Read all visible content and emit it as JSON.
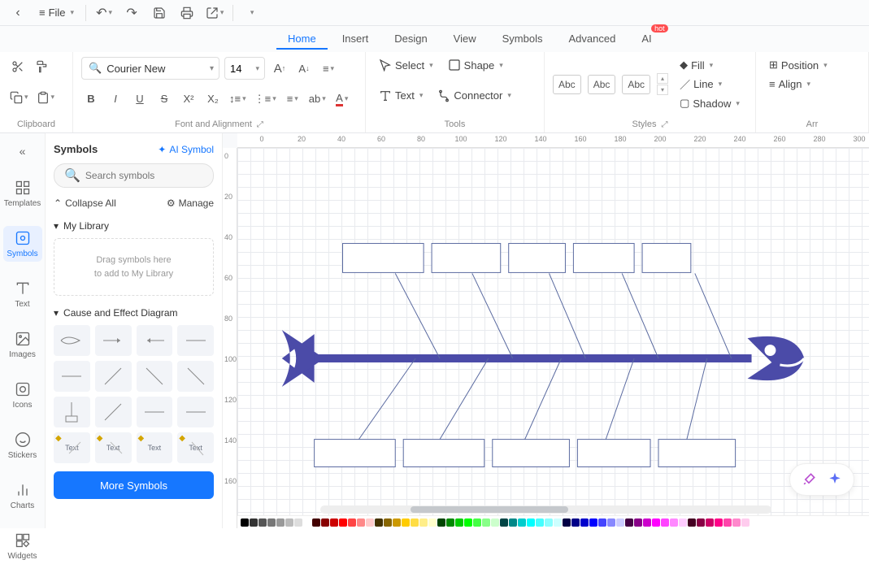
{
  "titlebar": {
    "file_label": "File"
  },
  "menu": {
    "items": [
      "Home",
      "Insert",
      "Design",
      "View",
      "Symbols",
      "Advanced",
      "AI"
    ],
    "active": 0,
    "hot_label": "hot"
  },
  "ribbon": {
    "clipboard_label": "Clipboard",
    "font": {
      "name": "Courier New",
      "size": "14"
    },
    "font_align_label": "Font and Alignment",
    "tools": {
      "select": "Select",
      "shape": "Shape",
      "text": "Text",
      "connector": "Connector",
      "label": "Tools"
    },
    "styles": {
      "abc": "Abc",
      "label": "Styles",
      "fill": "Fill",
      "line": "Line",
      "shadow": "Shadow"
    },
    "arrange": {
      "position": "Position",
      "align": "Align",
      "label": "Arr"
    }
  },
  "leftbar": {
    "items": [
      {
        "label": "Templates"
      },
      {
        "label": "Symbols"
      },
      {
        "label": "Text"
      },
      {
        "label": "Images"
      },
      {
        "label": "Icons"
      },
      {
        "label": "Stickers"
      },
      {
        "label": "Charts"
      },
      {
        "label": "Widgets"
      }
    ],
    "active": 1
  },
  "symbols_panel": {
    "title": "Symbols",
    "ai_symbol": "AI Symbol",
    "search_placeholder": "Search symbols",
    "collapse_all": "Collapse All",
    "manage": "Manage",
    "my_library": "My Library",
    "drop_hint_line1": "Drag symbols here",
    "drop_hint_line2": "to add to My Library",
    "cause_effect": "Cause and Effect Diagram",
    "text_label": "Text",
    "more_symbols": "More Symbols"
  },
  "ruler_h": [
    0,
    20,
    40,
    60,
    80,
    100,
    120,
    140,
    160,
    180,
    200,
    220,
    240,
    260,
    280,
    300
  ],
  "ruler_v": [
    0,
    20,
    40,
    60,
    80,
    100,
    120,
    140,
    160
  ],
  "colors": [
    "#000",
    "#333",
    "#555",
    "#777",
    "#999",
    "#bbb",
    "#ddd",
    "#fff",
    "#400",
    "#800",
    "#c00",
    "#f00",
    "#f44",
    "#f88",
    "#fcc",
    "#430",
    "#860",
    "#c90",
    "#fc0",
    "#fd4",
    "#fe8",
    "#ffc",
    "#040",
    "#080",
    "#0c0",
    "#0f0",
    "#4f4",
    "#8f8",
    "#cfc",
    "#044",
    "#088",
    "#0cc",
    "#0ff",
    "#4ff",
    "#8ff",
    "#cff",
    "#004",
    "#008",
    "#00c",
    "#00f",
    "#44f",
    "#88f",
    "#ccf",
    "#404",
    "#808",
    "#c0c",
    "#f0f",
    "#f4f",
    "#f8f",
    "#fcf",
    "#402",
    "#804",
    "#c06",
    "#f08",
    "#f4a",
    "#f8c",
    "#fce"
  ]
}
